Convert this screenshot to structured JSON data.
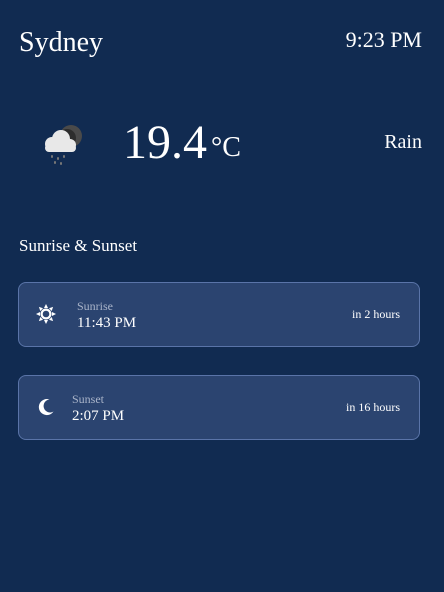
{
  "header": {
    "city": "Sydney",
    "time": "9:23 PM"
  },
  "current": {
    "icon": "cloud-rain-night-icon",
    "temperature": "19.4",
    "unit": "°C",
    "condition": "Rain"
  },
  "sun": {
    "title": "Sunrise & Sunset",
    "sunrise": {
      "icon": "sun-icon",
      "label": "Sunrise",
      "time": "11:43 PM",
      "relative": "in 2 hours"
    },
    "sunset": {
      "icon": "moon-icon",
      "label": "Sunset",
      "time": "2:07 PM",
      "relative": "in 16 hours"
    }
  },
  "colors": {
    "background": "#112b51",
    "card": "#2b4470",
    "card_border": "#5a74a8",
    "muted_text": "#a9b4c9"
  }
}
